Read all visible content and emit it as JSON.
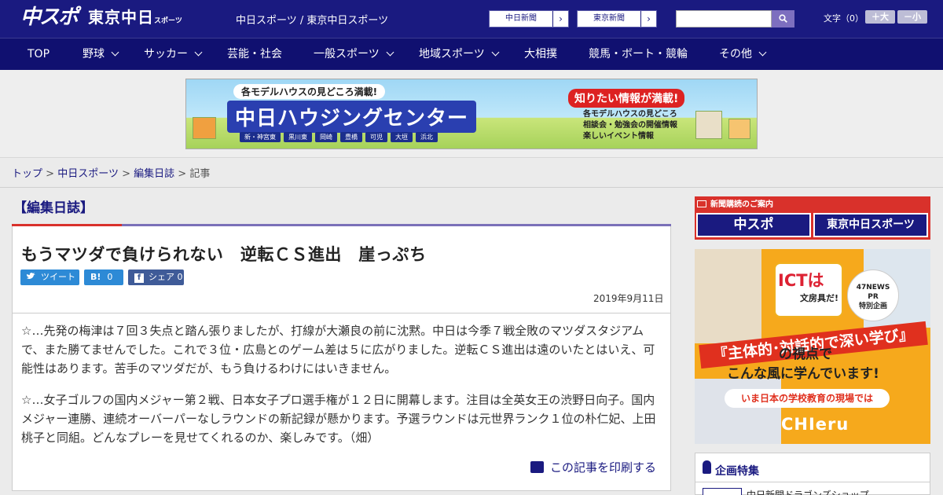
{
  "header": {
    "logo_chuspo": "中スポ",
    "logo_tokyo": "東京中日",
    "logo_tokyo_small": "スポーツ",
    "site_title": "中日スポーツ / 東京中日スポーツ",
    "paper_links": [
      "中日新聞",
      "東京新聞"
    ],
    "search_icon": "search-icon",
    "font_size_label": "文字（0）",
    "font_larger": "＋大",
    "font_smaller": "－小"
  },
  "nav": {
    "items": [
      {
        "label": "TOP"
      },
      {
        "label": "野球"
      },
      {
        "label": "サッカー"
      },
      {
        "label": "芸能・社会"
      },
      {
        "label": "一般スポーツ"
      },
      {
        "label": "地域スポーツ"
      },
      {
        "label": "大相撲"
      },
      {
        "label": "競馬・ボート・競輪"
      },
      {
        "label": "その他"
      }
    ]
  },
  "banner": {
    "top": "各モデルハウスの見どころ満載!",
    "main": "中日ハウジングセンター",
    "cities": [
      "新・神宮東",
      "黒川東",
      "岡崎",
      "豊橋",
      "可児",
      "大垣",
      "浜北"
    ],
    "right_title": "知りたい情報が満載!",
    "right_lines": [
      "各モデルハウスの見どころ",
      "相談会・勉強会の開催情報",
      "楽しいイベント情報"
    ]
  },
  "breadcrumb": {
    "items": [
      "トップ",
      "中日スポーツ",
      "編集日誌"
    ],
    "separator": ">",
    "current": "記事"
  },
  "article": {
    "section": "【編集日誌】",
    "title": "もうマツダで負けられない　逆転ＣＳ進出　崖っぷち",
    "share": {
      "tweet": "ツイート",
      "hatena_label": "B!",
      "hatena_count": "0",
      "facebook": "シェア",
      "facebook_count": "0"
    },
    "date": "2019年9月11日",
    "paragraphs": [
      "☆…先発の梅津は７回３失点と踏ん張りましたが、打線が大瀬良の前に沈黙。中日は今季７戦全敗のマツダスタジアムで、また勝てませんでした。これで３位・広島とのゲーム差は５に広がりました。逆転ＣＳ進出は遠のいたとはいえ、可能性はあります。苦手のマツダだが、もう負けるわけにはいきません。",
      "☆…女子ゴルフの国内メジャー第２戦、日本女子プロ選手権が１２日に開幕します。注目は全英女王の渋野日向子。国内メジャー連勝、連続オーバーパーなしラウンドの新記録が懸かります。予選ラウンドは元世界ランク１位の朴仁妃、上田桃子と同組。どんなプレーを見せてくれるのか、楽しみです。（畑）"
    ],
    "print": "この記事を印刷する"
  },
  "sidebar": {
    "subscribe_title": "新聞購読のご案内",
    "subscribe_buttons": [
      "中スポ",
      "東京中日スポーツ"
    ],
    "ad": {
      "ict": "ICTは",
      "ict_sub": "文房具だ!",
      "badge": [
        "47NEWS",
        "PR",
        "特別企画"
      ],
      "headline": "『主体的･対話的で深い学び』",
      "line2": "の視点で",
      "line3": "こんな風に学んでいます!",
      "pill": "いま日本の学校教育の現場では",
      "brand": "CHIeru"
    },
    "feature_title": "企画特集",
    "feature_item": "中日新聞ドラゴンズショップ"
  }
}
